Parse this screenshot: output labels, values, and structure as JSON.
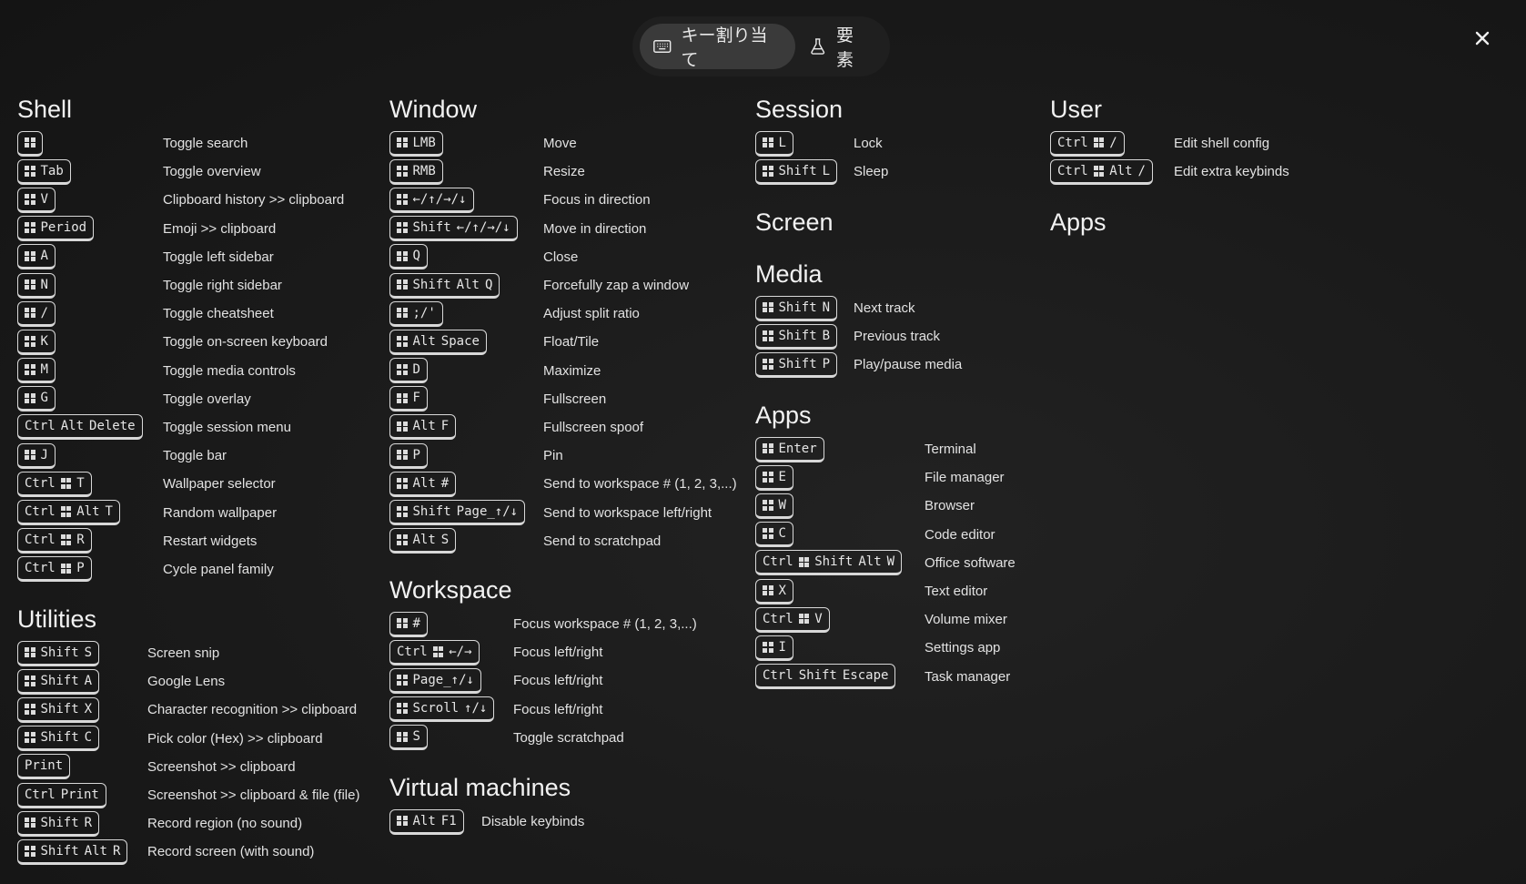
{
  "tabs": [
    {
      "label": "キー割り当て",
      "icon": "keyboard-icon",
      "active": true
    },
    {
      "label": "要素",
      "icon": "flask-icon",
      "active": false
    }
  ],
  "sections": {
    "shell": {
      "title": "Shell",
      "items": [
        {
          "keys": [
            "⊞"
          ],
          "desc": "Toggle search"
        },
        {
          "keys": [
            "⊞",
            "Tab"
          ],
          "desc": "Toggle overview"
        },
        {
          "keys": [
            "⊞",
            "V"
          ],
          "desc": "Clipboard history >> clipboard"
        },
        {
          "keys": [
            "⊞",
            "Period"
          ],
          "desc": "Emoji >> clipboard"
        },
        {
          "keys": [
            "⊞",
            "A"
          ],
          "desc": "Toggle left sidebar"
        },
        {
          "keys": [
            "⊞",
            "N"
          ],
          "desc": "Toggle right sidebar"
        },
        {
          "keys": [
            "⊞",
            "/"
          ],
          "desc": "Toggle cheatsheet"
        },
        {
          "keys": [
            "⊞",
            "K"
          ],
          "desc": "Toggle on-screen keyboard"
        },
        {
          "keys": [
            "⊞",
            "M"
          ],
          "desc": "Toggle media controls"
        },
        {
          "keys": [
            "⊞",
            "G"
          ],
          "desc": "Toggle overlay"
        },
        {
          "keys": [
            "Ctrl",
            "Alt",
            "Delete"
          ],
          "desc": "Toggle session menu"
        },
        {
          "keys": [
            "⊞",
            "J"
          ],
          "desc": "Toggle bar"
        },
        {
          "keys": [
            "Ctrl",
            "⊞",
            "T"
          ],
          "desc": "Wallpaper selector"
        },
        {
          "keys": [
            "Ctrl",
            "⊞",
            "Alt",
            "T"
          ],
          "desc": "Random wallpaper"
        },
        {
          "keys": [
            "Ctrl",
            "⊞",
            "R"
          ],
          "desc": "Restart widgets"
        },
        {
          "keys": [
            "Ctrl",
            "⊞",
            "P"
          ],
          "desc": "Cycle panel family"
        }
      ]
    },
    "utilities": {
      "title": "Utilities",
      "items": [
        {
          "keys": [
            "⊞",
            "Shift",
            "S"
          ],
          "desc": "Screen snip"
        },
        {
          "keys": [
            "⊞",
            "Shift",
            "A"
          ],
          "desc": "Google Lens"
        },
        {
          "keys": [
            "⊞",
            "Shift",
            "X"
          ],
          "desc": "Character recognition >> clipboard"
        },
        {
          "keys": [
            "⊞",
            "Shift",
            "C"
          ],
          "desc": "Pick color (Hex) >> clipboard"
        },
        {
          "keys": [
            "Print"
          ],
          "desc": "Screenshot >> clipboard"
        },
        {
          "keys": [
            "Ctrl",
            "Print"
          ],
          "desc": "Screenshot >> clipboard & file (file)"
        },
        {
          "keys": [
            "⊞",
            "Shift",
            "R"
          ],
          "desc": "Record region (no sound)"
        },
        {
          "keys": [
            "⊞",
            "Shift",
            "Alt",
            "R"
          ],
          "desc": "Record screen (with sound)"
        }
      ]
    },
    "window": {
      "title": "Window",
      "items": [
        {
          "keys": [
            "⊞",
            "LMB"
          ],
          "desc": "Move"
        },
        {
          "keys": [
            "⊞",
            "RMB"
          ],
          "desc": "Resize"
        },
        {
          "keys": [
            "⊞",
            "←/↑/→/↓"
          ],
          "desc": "Focus in direction"
        },
        {
          "keys": [
            "⊞",
            "Shift",
            "←/↑/→/↓"
          ],
          "desc": "Move in direction"
        },
        {
          "keys": [
            "⊞",
            "Q"
          ],
          "desc": "Close"
        },
        {
          "keys": [
            "⊞",
            "Shift",
            "Alt",
            "Q"
          ],
          "desc": "Forcefully zap a window"
        },
        {
          "keys": [
            "⊞",
            ";/'"
          ],
          "desc": "Adjust split ratio"
        },
        {
          "keys": [
            "⊞",
            "Alt",
            "Space"
          ],
          "desc": "Float/Tile"
        },
        {
          "keys": [
            "⊞",
            "D"
          ],
          "desc": "Maximize"
        },
        {
          "keys": [
            "⊞",
            "F"
          ],
          "desc": "Fullscreen"
        },
        {
          "keys": [
            "⊞",
            "Alt",
            "F"
          ],
          "desc": "Fullscreen spoof"
        },
        {
          "keys": [
            "⊞",
            "P"
          ],
          "desc": "Pin"
        },
        {
          "keys": [
            "⊞",
            "Alt",
            "#"
          ],
          "desc": "Send to workspace # (1, 2, 3,...)"
        },
        {
          "keys": [
            "⊞",
            "Shift",
            "Page_↑/↓"
          ],
          "desc": "Send to workspace left/right"
        },
        {
          "keys": [
            "⊞",
            "Alt",
            "S"
          ],
          "desc": "Send to scratchpad"
        }
      ]
    },
    "workspace": {
      "title": "Workspace",
      "items": [
        {
          "keys": [
            "⊞",
            "#"
          ],
          "desc": "Focus workspace # (1, 2, 3,...)"
        },
        {
          "keys": [
            "Ctrl",
            "⊞",
            "←/→"
          ],
          "desc": "Focus left/right"
        },
        {
          "keys": [
            "⊞",
            "Page_↑/↓"
          ],
          "desc": "Focus left/right"
        },
        {
          "keys": [
            "⊞",
            "Scroll",
            "↑/↓"
          ],
          "desc": "Focus left/right"
        },
        {
          "keys": [
            "⊞",
            "S"
          ],
          "desc": "Toggle scratchpad"
        }
      ]
    },
    "virtual": {
      "title": "Virtual machines",
      "items": [
        {
          "keys": [
            "⊞",
            "Alt",
            "F1"
          ],
          "desc": "Disable keybinds"
        }
      ]
    },
    "session": {
      "title": "Session",
      "items": [
        {
          "keys": [
            "⊞",
            "L"
          ],
          "desc": "Lock"
        },
        {
          "keys": [
            "⊞",
            "Shift",
            "L"
          ],
          "desc": "Sleep"
        }
      ]
    },
    "screen": {
      "title": "Screen",
      "items": []
    },
    "media": {
      "title": "Media",
      "items": [
        {
          "keys": [
            "⊞",
            "Shift",
            "N"
          ],
          "desc": "Next track"
        },
        {
          "keys": [
            "⊞",
            "Shift",
            "B"
          ],
          "desc": "Previous track"
        },
        {
          "keys": [
            "⊞",
            "Shift",
            "P"
          ],
          "desc": "Play/pause media"
        }
      ]
    },
    "apps": {
      "title": "Apps",
      "items": [
        {
          "keys": [
            "⊞",
            "Enter"
          ],
          "desc": "Terminal"
        },
        {
          "keys": [
            "⊞",
            "E"
          ],
          "desc": "File manager"
        },
        {
          "keys": [
            "⊞",
            "W"
          ],
          "desc": "Browser"
        },
        {
          "keys": [
            "⊞",
            "C"
          ],
          "desc": "Code editor"
        },
        {
          "keys": [
            "Ctrl",
            "⊞",
            "Shift",
            "Alt",
            "W"
          ],
          "desc": "Office software"
        },
        {
          "keys": [
            "⊞",
            "X"
          ],
          "desc": "Text editor"
        },
        {
          "keys": [
            "Ctrl",
            "⊞",
            "V"
          ],
          "desc": "Volume mixer"
        },
        {
          "keys": [
            "⊞",
            "I"
          ],
          "desc": "Settings app"
        },
        {
          "keys": [
            "Ctrl",
            "Shift",
            "Escape"
          ],
          "desc": "Task manager"
        }
      ]
    },
    "user": {
      "title": "User",
      "items": [
        {
          "keys": [
            "Ctrl",
            "⊞",
            "/"
          ],
          "desc": "Edit shell config"
        },
        {
          "keys": [
            "Ctrl",
            "⊞",
            "Alt",
            "/"
          ],
          "desc": "Edit extra keybinds"
        }
      ]
    },
    "apps2": {
      "title": "Apps",
      "items": []
    }
  }
}
